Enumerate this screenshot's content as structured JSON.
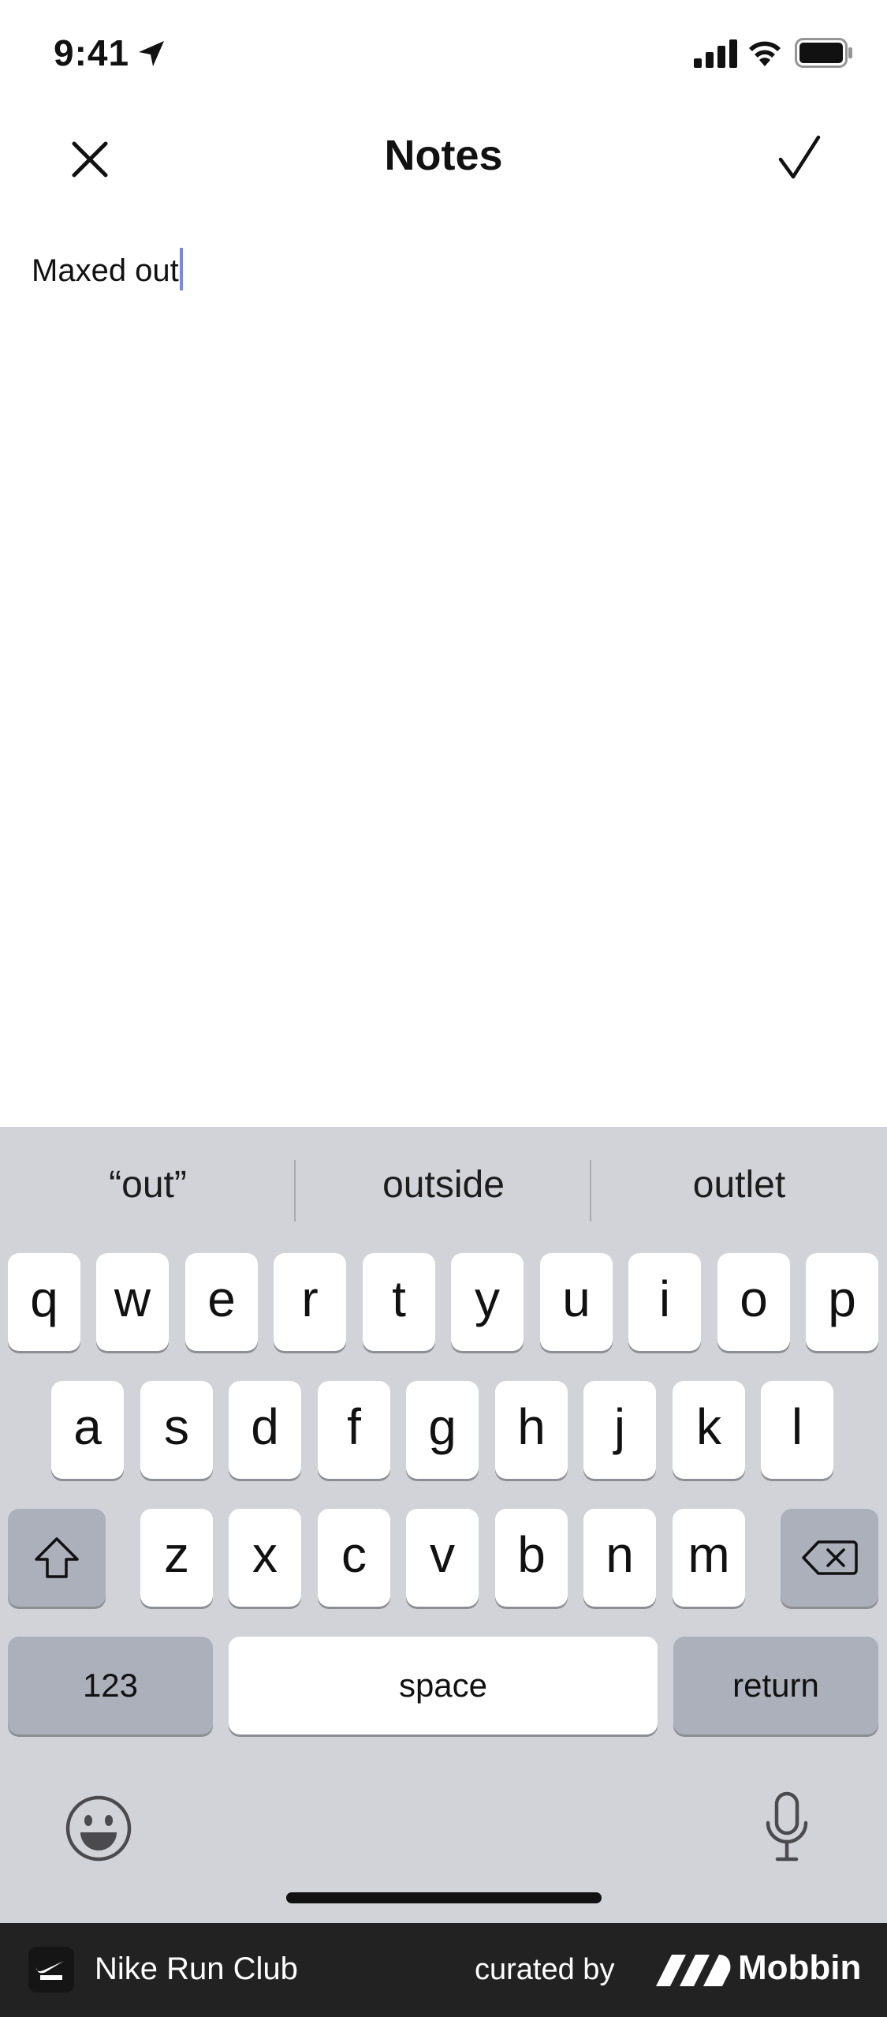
{
  "status_bar": {
    "time": "9:41"
  },
  "header": {
    "title": "Notes"
  },
  "note": {
    "text": "Maxed out"
  },
  "keyboard": {
    "suggestions": [
      "“out”",
      "outside",
      "outlet"
    ],
    "row1": [
      "q",
      "w",
      "e",
      "r",
      "t",
      "y",
      "u",
      "i",
      "o",
      "p"
    ],
    "row2": [
      "a",
      "s",
      "d",
      "f",
      "g",
      "h",
      "j",
      "k",
      "l"
    ],
    "row3": [
      "z",
      "x",
      "c",
      "v",
      "b",
      "n",
      "m"
    ],
    "numbers_label": "123",
    "space_label": "space",
    "return_label": "return"
  },
  "footer": {
    "app_name": "Nike Run Club",
    "curated_by": "curated by",
    "brand": "Mobbin"
  },
  "icons": {
    "location": "location-arrow-icon",
    "signal": "cellular-signal-icon",
    "wifi": "wifi-icon",
    "battery": "battery-icon",
    "close": "close-icon",
    "done": "checkmark-icon",
    "shift": "shift-icon",
    "delete": "backspace-icon",
    "emoji": "emoji-icon",
    "mic": "microphone-icon"
  },
  "colors": {
    "keyboard_bg": "#d1d3d9",
    "key": "#ffffff",
    "special_key": "#abb0bb",
    "caret": "#7a86e8",
    "footer_bg": "#222222"
  }
}
